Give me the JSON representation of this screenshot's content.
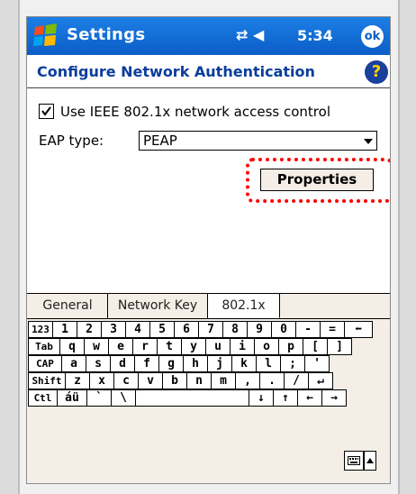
{
  "titlebar": {
    "title": "Settings",
    "status_icons": "⇄ ◀",
    "time": "5:34",
    "ok_label": "ok"
  },
  "page": {
    "title": "Configure Network Authentication",
    "help": "?"
  },
  "form": {
    "checkbox_label": "Use IEEE 802.1x network access control",
    "checkbox_checked": true,
    "eap_label": "EAP type:",
    "eap_value": "PEAP",
    "properties_label": "Properties"
  },
  "tabs": [
    "General",
    "Network Key",
    "802.1x"
  ],
  "keyboard": {
    "rows": [
      [
        "123",
        "1",
        "2",
        "3",
        "4",
        "5",
        "6",
        "7",
        "8",
        "9",
        "0",
        "-",
        "=",
        "⬅"
      ],
      [
        "Tab",
        "q",
        "w",
        "e",
        "r",
        "t",
        "y",
        "u",
        "i",
        "o",
        "p",
        "[",
        "]"
      ],
      [
        "CAP",
        "a",
        "s",
        "d",
        "f",
        "g",
        "h",
        "j",
        "k",
        "l",
        ";",
        "'"
      ],
      [
        "Shift",
        "z",
        "x",
        "c",
        "v",
        "b",
        "n",
        "m",
        ",",
        ".",
        "/",
        "↵"
      ],
      [
        "Ctl",
        "áü",
        "`",
        "\\",
        "",
        "↓",
        "↑",
        "←",
        "→"
      ]
    ]
  }
}
